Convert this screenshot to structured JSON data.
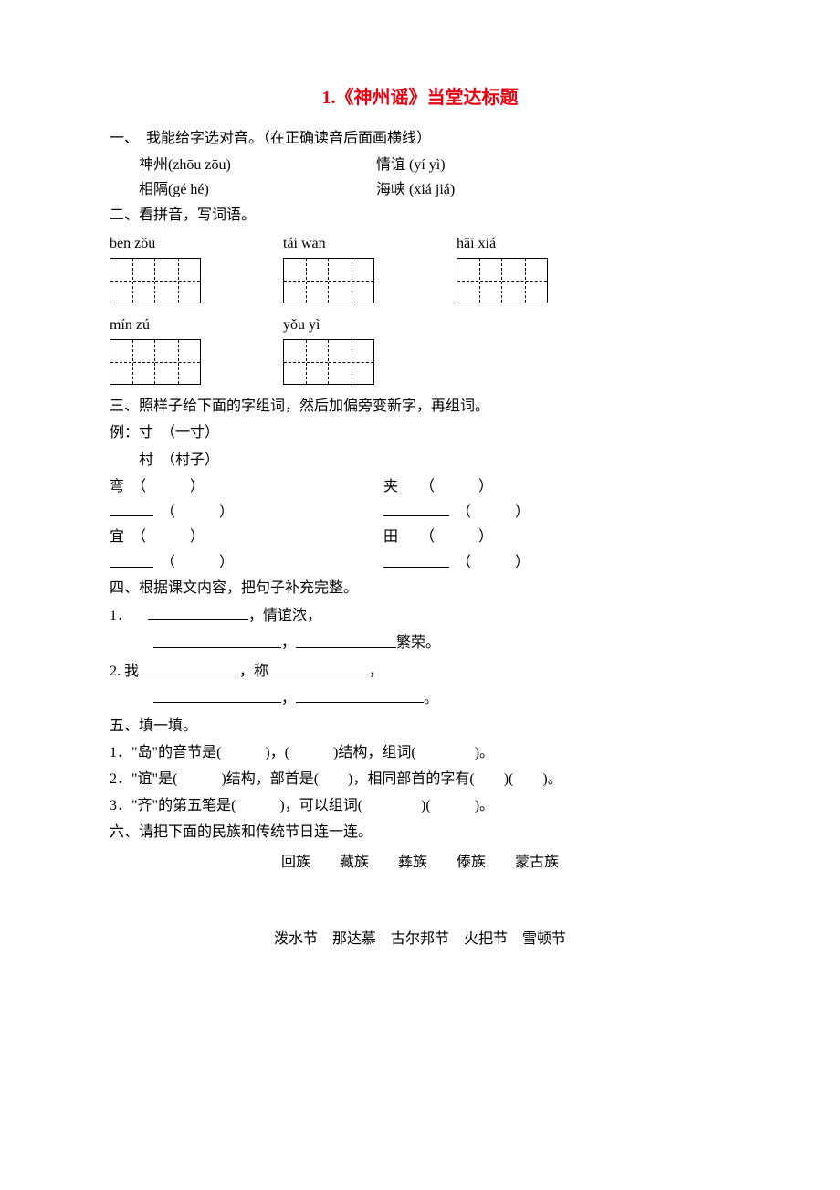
{
  "title": "1.《神州谣》当堂达标题",
  "s1": {
    "heading": "一、　我能给字选对音。（在正确读音后面画横线）",
    "items": [
      {
        "left": "神州(zhōu  zōu)",
        "right": "情谊 (yí  yì)"
      },
      {
        "left": "相隔(gé   hé)",
        "right": "海峡 (xiá   jiá)"
      }
    ]
  },
  "s2": {
    "heading": "二、看拼音，写词语。",
    "pinyin_rows": [
      [
        "bēn  zǒu",
        "tái  wān",
        "hǎi  xiá"
      ],
      [
        "mín  zú",
        "yǒu  yì"
      ]
    ]
  },
  "s3": {
    "heading": "三、照样子给下面的字组词，然后加偏旁变新字，再组词。",
    "example_l1": "例：寸　（一寸）",
    "example_l2": "　　村　（村子）",
    "rows": [
      {
        "a": "弯　（　　　）",
        "b": "夹　　（　　　）"
      },
      {
        "a_blank": true,
        "b_blank": true
      },
      {
        "a": "宜　（　　　）",
        "b": "田　　（　　　）"
      },
      {
        "a_blank": true,
        "b_blank": true
      }
    ]
  },
  "s4": {
    "heading": "四、根据课文内容，把句子补充完整。",
    "lines": [
      "1．",
      "2. 我"
    ],
    "blank_label_1a": "，情谊浓，",
    "blank_label_1b_prefix": "，",
    "blank_label_1b_suffix": "繁荣。",
    "line2_mid": "，称",
    "line2_end": "，",
    "line3_mid": "，",
    "line3_end": "。"
  },
  "s5": {
    "heading": "五、填一填。",
    "items": [
      "1．\"岛\"的音节是(　　　)，(　　　)结构，组词(　　　　)。",
      "2．\"谊\"是(　　　)结构，部首是(　　)，相同部首的字有(　　)(　　)。",
      "3．\"齐\"的第五笔是(　　　)，可以组词(　　　　)(　　　)。"
    ]
  },
  "s6": {
    "heading": "六、请把下面的民族和传统节日连一连。",
    "top_line": "回族　　藏族　　彝族　　傣族　　蒙古族",
    "bottom_line": "泼水节　那达慕　古尔邦节　火把节　雪顿节"
  }
}
